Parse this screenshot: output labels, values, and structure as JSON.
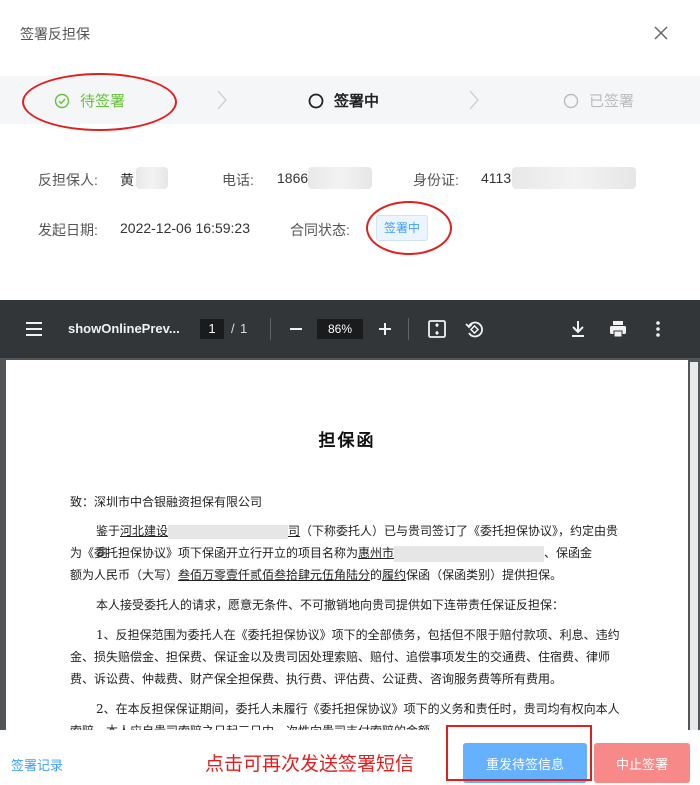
{
  "header": {
    "title": "签署反担保"
  },
  "steps": [
    {
      "label": "待签署",
      "state": "done"
    },
    {
      "label": "签署中",
      "state": "active"
    },
    {
      "label": "已签署",
      "state": "pending"
    }
  ],
  "info": {
    "guarantor_label": "反担保人:",
    "guarantor_value": "黄",
    "phone_label": "电话:",
    "phone_value": "1866",
    "id_label": "身份证:",
    "id_value": "4113",
    "date_label": "发起日期:",
    "date_value": "2022-12-06 16:59:23",
    "status_label": "合同状态:",
    "status_value": "签署中"
  },
  "pdf": {
    "filename": "showOnlinePrev...",
    "page_current": "1",
    "page_sep": "/",
    "page_total": "1",
    "zoom": "86%"
  },
  "document": {
    "title": "担保函",
    "to": "致：深圳市中合银融资担保有限公司",
    "p1_a": "鉴于",
    "p1_b": "河北建设",
    "p1_c": "司",
    "p1_d": "（下称委托人）已与贵司签订了《委托担保协议》，约定由贵司",
    "p1_e": "为《委托担保协议》项下保函开立行开立的项目名称为",
    "p1_f": "惠州市",
    "p1_g": "、保函金",
    "p1_h": "额为人民币（大写）",
    "p1_i": "叁佰万零壹仟贰佰叁拾肆元伍角陆分",
    "p1_j": "的",
    "p1_k": "履约",
    "p1_l": "保函（保函类别）提供担保。",
    "p2": "本人接受委托人的请求，愿意无条件、不可撤销地向贵司提供如下连带责任保证反担保：",
    "p3_a": "1、反担保范围为委托人在《委托担保协议》项下的全部债务，包括但不限于赔付款项、利息、违约",
    "p3_b": "金、损失赔偿金、担保费、保证金以及贵司因处理索赔、赔付、追偿事项发生的交通费、住宿费、律师",
    "p3_c": "费、诉讼费、仲裁费、财产保全担保费、执行费、评估费、公证费、咨询服务费等所有费用。",
    "p4_a": "2、在本反担保保证期间，委托人未履行《委托担保协议》项下的义务和责任时，贵司均有权向本人",
    "p4_b": "索赔，本人应自贵司索赔之日起三日内一次性向贵司支付索赔的金额。"
  },
  "footer": {
    "record_link": "签署记录",
    "hint": "点击可再次发送签署短信",
    "resend_button": "重发待签信息",
    "stop_button": "中止签署"
  },
  "colors": {
    "step_done": "#67c23a",
    "primary": "#409eff",
    "danger": "#f78989",
    "annotation_red": "#e02020"
  }
}
